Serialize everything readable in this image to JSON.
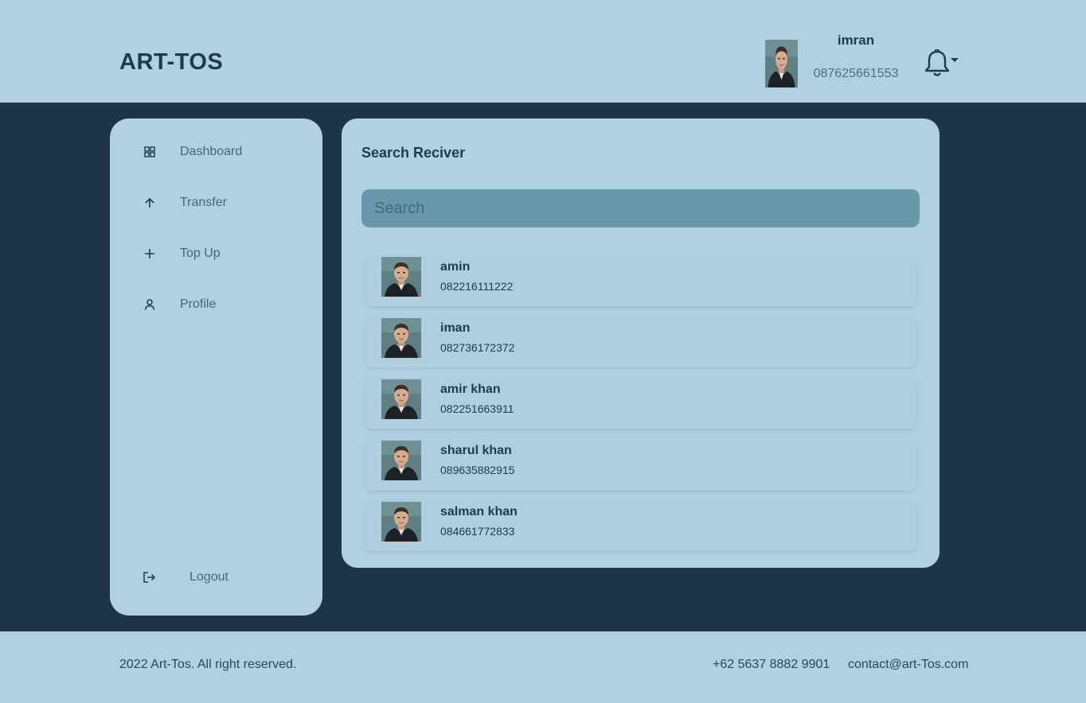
{
  "header": {
    "brand": "ART-TOS",
    "user": {
      "name": "imran",
      "phone": "087625661553"
    }
  },
  "sidebar": {
    "items": [
      {
        "label": "Dashboard",
        "icon": "grid-icon"
      },
      {
        "label": "Transfer",
        "icon": "arrow-up-icon"
      },
      {
        "label": "Top Up",
        "icon": "plus-icon"
      },
      {
        "label": "Profile",
        "icon": "user-icon"
      }
    ],
    "logout": {
      "label": "Logout",
      "icon": "logout-icon"
    }
  },
  "main": {
    "title": "Search Reciver",
    "search": {
      "placeholder": "Search",
      "value": ""
    },
    "receivers": [
      {
        "name": "amin",
        "phone": "082216111222"
      },
      {
        "name": "iman",
        "phone": "082736172372"
      },
      {
        "name": "amir khan",
        "phone": "082251663911"
      },
      {
        "name": "sharul khan",
        "phone": "089635882915"
      },
      {
        "name": "salman khan",
        "phone": "084661772833"
      }
    ]
  },
  "footer": {
    "copyright": "2022 Art-Tos. All right reserved.",
    "phone": "+62 5637 8882 9901",
    "email": "contact@art-Tos.com"
  },
  "colors": {
    "background": "#1c354b",
    "panel": "#b1d0e1",
    "search": "#6998ab",
    "text_dark": "#1c3a52"
  }
}
